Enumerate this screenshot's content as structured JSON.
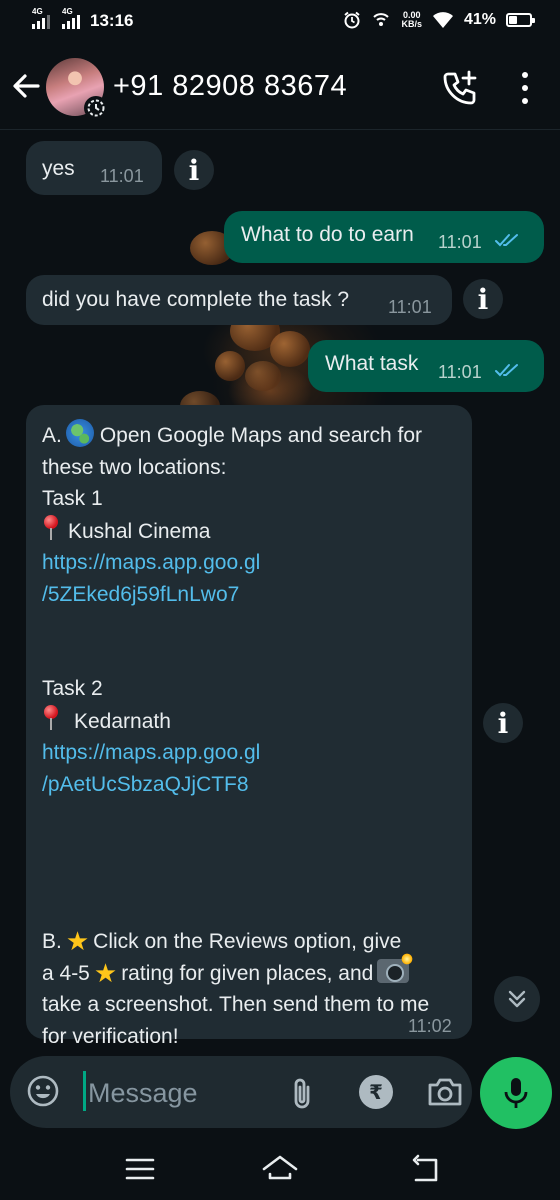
{
  "status_bar": {
    "network1": "4G",
    "network2": "4G",
    "time": "13:16",
    "speed_value": "0.00",
    "speed_unit": "KB/s",
    "battery": "41%",
    "battery_level": 0.41
  },
  "header": {
    "contact": "+91 82908 83674"
  },
  "messages": [
    {
      "direction": "incoming",
      "text": "yes",
      "time": "11:01"
    },
    {
      "direction": "outgoing",
      "text": "What to do to earn",
      "time": "11:01",
      "status": "read"
    },
    {
      "direction": "incoming",
      "text": "did you have complete the task ?",
      "time": "11:01"
    },
    {
      "direction": "outgoing",
      "text": "What task",
      "time": "11:01",
      "status": "read"
    },
    {
      "direction": "incoming",
      "time": "11:02",
      "lines": {
        "l1": "A.",
        "l1b": "Open Google Maps and search for",
        "l2": "these two locations:",
        "l3": "Task 1",
        "l4": "Kushal Cinema",
        "l5": "https://maps.app.goo.gl",
        "l6": "/5ZEked6j59fLnLwo7",
        "l7": "Task 2",
        "l8": "Kedarnath",
        "l9": "https://maps.app.goo.gl",
        "l10": "/pAetUcSbzaQJjCTF8",
        "l11": "B.",
        "l11b": "Click on the Reviews option, give",
        "l12a": "a 4-5",
        "l12b": "rating for given places, and",
        "l13": "take a screenshot. Then send them to me",
        "l14": "for verification!"
      }
    }
  ],
  "info_icon": "i",
  "composer": {
    "placeholder": "Message",
    "currency_symbol": "₹"
  },
  "icons": {
    "back": "arrow-left-icon",
    "call_add": "call-add-icon",
    "menu": "kebab-icon",
    "emoji": "emoji-icon",
    "attach": "paperclip-icon",
    "camera": "camera-icon",
    "mic": "mic-icon"
  },
  "colors": {
    "background": "#0b1014",
    "incoming_bubble": "#202c33",
    "outgoing_bubble": "#005c4b",
    "link": "#53bdeb",
    "accent": "#21c063"
  }
}
